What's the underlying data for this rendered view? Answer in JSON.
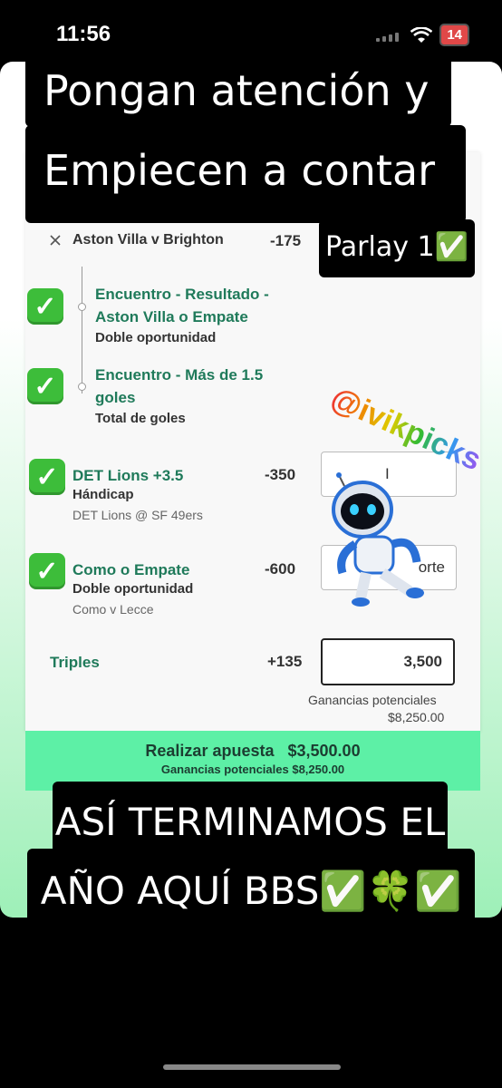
{
  "status": {
    "time": "11:56",
    "battery": "14"
  },
  "header": {
    "line1": "Pongan atención y",
    "line2": "Empiecen a contar"
  },
  "parlay_badge": "Parlay 1✅",
  "handle": "@ivikpicks",
  "bet_slip": {
    "game1": {
      "title": "Aston Villa v Brighton",
      "odds": "-175"
    },
    "leg1": {
      "market1": "Encuentro - Resultado -",
      "market2": "Aston Villa o Empate",
      "type": "Doble oportunidad"
    },
    "leg2": {
      "market1": "Encuentro - Más de 1.5",
      "market2": "goles",
      "type": "Total de goles"
    },
    "leg3": {
      "market": "DET Lions +3.5",
      "type": "Hándicap",
      "match": "DET Lions @ SF 49ers",
      "odds": "-350",
      "input_value": "I"
    },
    "leg4": {
      "market": "Como o Empate",
      "type": "Doble oportunidad",
      "match": "Como v Lecce",
      "odds": "-600",
      "input_value": "orte"
    },
    "triples": {
      "label": "Triples",
      "odds": "+135",
      "stake": "3,500"
    },
    "potential_label": "Ganancias potenciales",
    "potential_value": "$8,250.00",
    "place_bet": {
      "label": "Realizar apuesta",
      "amount": "$3,500.00",
      "potential": "Ganancias potenciales $8,250.00"
    }
  },
  "footer": {
    "line1": "ASÍ TERMINAMOS EL",
    "line2": "AÑO AQUÍ BBS✅🍀✅"
  },
  "icons": {
    "check": "check-mark-icon",
    "close": "close-icon",
    "clover": "clover-icon",
    "wifi": "wifi-icon"
  },
  "colors": {
    "accent_green": "#1f7a5a",
    "place_bar": "#5df0a6",
    "check_green": "#3dbd3a"
  }
}
